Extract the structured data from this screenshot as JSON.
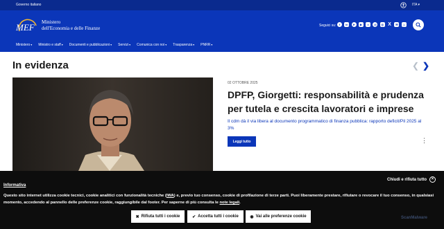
{
  "topbar": {
    "gov_label": "Governo italiano",
    "lang_label": "ITA"
  },
  "header": {
    "logo_letters": "MEF",
    "org_name_line1": "Ministero",
    "org_name_line2": "dell'Economia e delle Finanze",
    "follow_label": "Seguici su:",
    "socials": [
      "facebook-icon",
      "linkedin-icon",
      "telegram-icon",
      "youtube-icon",
      "flickr-icon",
      "threads-icon",
      "instagram-icon",
      "x-icon",
      "email-icon",
      "rss-icon"
    ],
    "nav": [
      {
        "label": "Ministero"
      },
      {
        "label": "Ministro e staff"
      },
      {
        "label": "Documenti e pubblicazioni"
      },
      {
        "label": "Servizi"
      },
      {
        "label": "Comunica con noi"
      },
      {
        "label": "Trasparenza"
      },
      {
        "label": "PNRR"
      }
    ]
  },
  "main": {
    "title": "In evidenza",
    "article": {
      "date": "02 OTTOBRE 2025",
      "headline": "DPFP, Giorgetti: responsabilità e prudenza per tutela e crescita lavoratori e imprese",
      "summary": "Il cdm dà il via libera al documento programmatico di finanza pubblica: rapporto deficit/Pil 2025 al 3%",
      "cta_label": "Leggi tutto"
    }
  },
  "cookie": {
    "close_label": "Chiudi e rifiuta tutto",
    "title": "Informativa",
    "text_before_link": "Questo sito internet utilizza cookie tecnici, cookie analitici con funzionalità tecniche (",
    "link1": "IWA",
    "text_mid": ") e, previo tuo consenso, cookie di profilazione di terze parti. Puoi liberamente prestare, rifiutare o revocare il tuo consenso, in qualsiasi momento, accedendo al pannello delle preferenze cookie, raggiungibile dal footer. Per saperne di più consulta le ",
    "link2": "note legali",
    "text_end": ".",
    "btn_reject": "Rifiuta tutti i cookie",
    "btn_accept": "Accetta tutti i cookie",
    "btn_prefs": "Vai alle preferenze cookie",
    "watermark": "ScanMalware"
  },
  "colors": {
    "brand_blue": "#0b36b9",
    "topbar_blue": "#0a2a8e",
    "banner_black": "#0d0d0d"
  }
}
